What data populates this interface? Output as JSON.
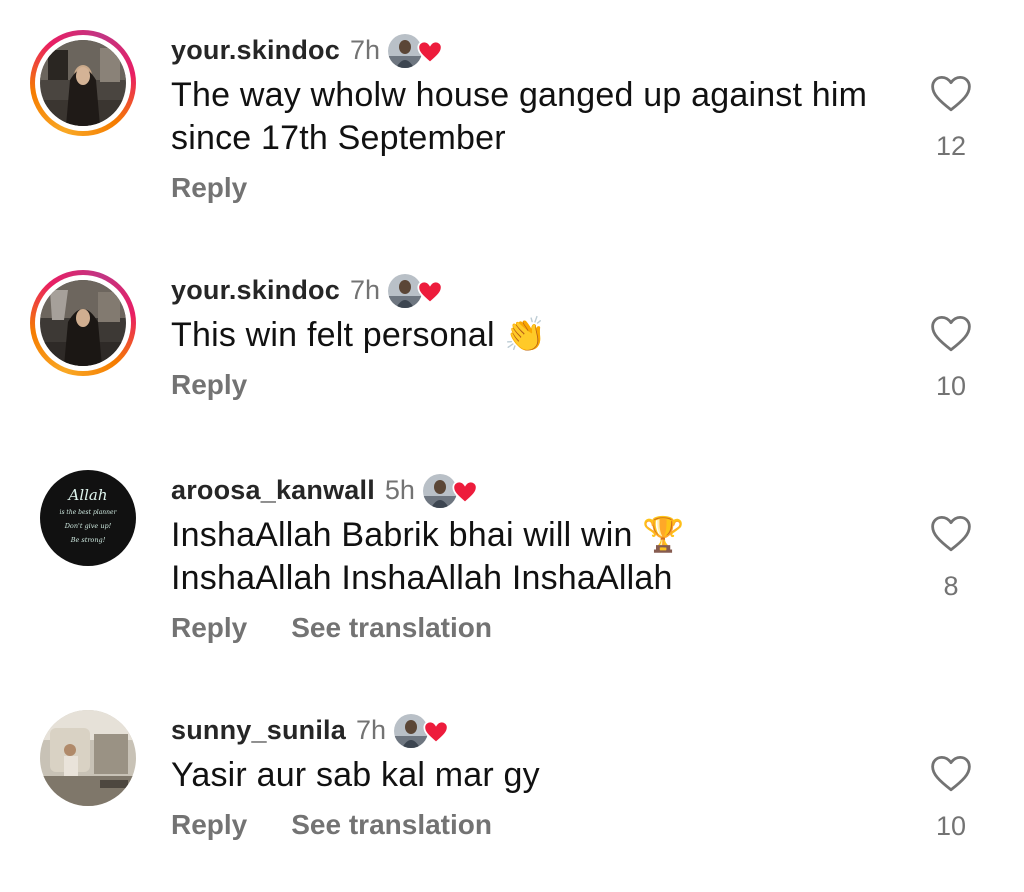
{
  "comments": [
    {
      "username": "your.skindoc",
      "time": "7h",
      "text": "The way wholw house ganged up against him since 17th September",
      "reply_label": "Reply",
      "likes": "12",
      "avatar": "woman-in-dark-room",
      "story_ring": true
    },
    {
      "username": "your.skindoc",
      "time": "7h",
      "text": "This win felt personal 👏",
      "reply_label": "Reply",
      "likes": "10",
      "avatar": "woman-in-dark-room",
      "story_ring": true
    },
    {
      "username": "aroosa_kanwall",
      "time": "5h",
      "text_line1": "InshaAllah Babrik bhai will win 🏆",
      "text_line2": "InshaAllah InshaAllah InshaAllah",
      "reply_label": "Reply",
      "translate_label": "See translation",
      "likes": "8",
      "avatar": "calligraphy-text-black",
      "avatar_text": {
        "line1": "Allah",
        "line2": "is the best planner",
        "line3": "Don't give up!",
        "line4": "Be strong!"
      }
    },
    {
      "username": "sunny_sunila",
      "time": "7h",
      "text": "Yasir aur sab kal mar gy",
      "reply_label": "Reply",
      "translate_label": "See translation",
      "likes": "10",
      "avatar": "room-photo"
    }
  ],
  "colors": {
    "username": "#262626",
    "secondary": "#737373",
    "heart_badge": "#ed1c3c"
  }
}
